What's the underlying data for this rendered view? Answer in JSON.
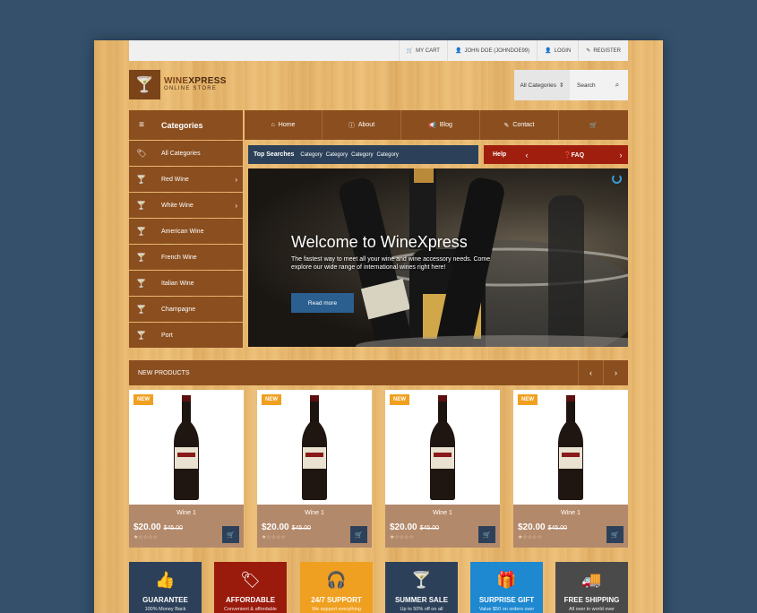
{
  "topbar": {
    "items": [
      {
        "icon": "cart-icon",
        "glyph": "🛒",
        "label": "MY CART"
      },
      {
        "icon": "user-icon",
        "glyph": "👤",
        "label": "JOHN DOE (JOHNDOE99)"
      },
      {
        "icon": "user-icon",
        "glyph": "👤",
        "label": "LOGIN"
      },
      {
        "icon": "pencil-icon",
        "glyph": "✎",
        "label": "REGISTER"
      }
    ]
  },
  "logo": {
    "glyph": "🍸",
    "brand_bold": "WINE",
    "brand_rest": "XPRESS",
    "tagline": "ONLINE STORE"
  },
  "search": {
    "category": "All Categories",
    "placeholder": "Search",
    "icon_glyph": "⌕"
  },
  "categories_header": {
    "icon": "menu-icon",
    "glyph": "≡",
    "label": "Categories"
  },
  "nav": {
    "items": [
      {
        "icon": "home-icon",
        "glyph": "⌂",
        "label": "Home"
      },
      {
        "icon": "info-icon",
        "glyph": "ⓘ",
        "label": "About"
      },
      {
        "icon": "megaphone-icon",
        "glyph": "📢",
        "label": "Blog"
      },
      {
        "icon": "edit-icon",
        "glyph": "✎",
        "label": "Contact"
      },
      {
        "icon": "cart-icon",
        "glyph": "🛒",
        "label": ""
      }
    ]
  },
  "sidebar": {
    "items": [
      {
        "icon": "tags-icon",
        "glyph": "🏷",
        "label": "All Categories",
        "arrow": ""
      },
      {
        "icon": "glass-icon",
        "glyph": "🍸",
        "label": "Red Wine",
        "arrow": "›"
      },
      {
        "icon": "glass-icon",
        "glyph": "🍸",
        "label": "White Wine",
        "arrow": "›"
      },
      {
        "icon": "glass-icon",
        "glyph": "🍸",
        "label": "American Wine",
        "arrow": ""
      },
      {
        "icon": "glass-icon",
        "glyph": "🍸",
        "label": "French Wine",
        "arrow": ""
      },
      {
        "icon": "glass-icon",
        "glyph": "🍸",
        "label": "Italian Wine",
        "arrow": ""
      },
      {
        "icon": "glass-icon",
        "glyph": "🍸",
        "label": "Champagne",
        "arrow": ""
      },
      {
        "icon": "glass-icon",
        "glyph": "🍸",
        "label": "Port",
        "arrow": ""
      }
    ]
  },
  "top_searches": {
    "label": "Top Searches",
    "tags": [
      "Category",
      "Category",
      "Category",
      "Category"
    ]
  },
  "help": {
    "label": "Help",
    "prev": "‹",
    "faq": "❓FAQ",
    "next": "›"
  },
  "hero": {
    "title": "Welcome to WineXpress",
    "subtitle": "The fastest way to meet all your wine and wine accessory needs. Come explore our wide range of international wines right here!",
    "button": "Read more"
  },
  "new_products": {
    "label": "NEW PRODUCTS",
    "prev": "‹",
    "next": "›"
  },
  "products": [
    {
      "badge": "NEW",
      "name": "Wine 1",
      "price": "$20.00",
      "old_price": "$45.00",
      "stars": "★☆☆☆☆"
    },
    {
      "badge": "NEW",
      "name": "Wine 1",
      "price": "$20.00",
      "old_price": "$45.00",
      "stars": "★☆☆☆☆"
    },
    {
      "badge": "NEW",
      "name": "Wine 1",
      "price": "$20.00",
      "old_price": "$45.00",
      "stars": "★☆☆☆☆"
    },
    {
      "badge": "NEW",
      "name": "Wine 1",
      "price": "$20.00",
      "old_price": "$45.00",
      "stars": "★☆☆☆☆"
    }
  ],
  "cart_glyph": "🛒",
  "features": [
    {
      "icon": "thumbs-up-icon",
      "glyph": "👍",
      "title": "GUARANTEE",
      "sub": "100% Money Back",
      "color": "#2c4159"
    },
    {
      "icon": "tags-icon",
      "glyph": "🏷",
      "title": "AFFORDABLE",
      "sub": "Convenient & affordable",
      "color": "#9a1a0c"
    },
    {
      "icon": "headset-icon",
      "glyph": "🎧",
      "title": "24/7 SUPPORT",
      "sub": "We support everything",
      "color": "#f0a020"
    },
    {
      "icon": "glass-icon",
      "glyph": "🍸",
      "title": "SUMMER SALE",
      "sub": "Up to 50% off on all",
      "color": "#2c4159"
    },
    {
      "icon": "gift-icon",
      "glyph": "🎁",
      "title": "SURPRISE GIFT",
      "sub": "Value $50 on orders over",
      "color": "#1e88d0"
    },
    {
      "icon": "truck-icon",
      "glyph": "🚚",
      "title": "FREE SHIPPING",
      "sub": "All over in world over",
      "color": "#4a4a4a"
    }
  ]
}
